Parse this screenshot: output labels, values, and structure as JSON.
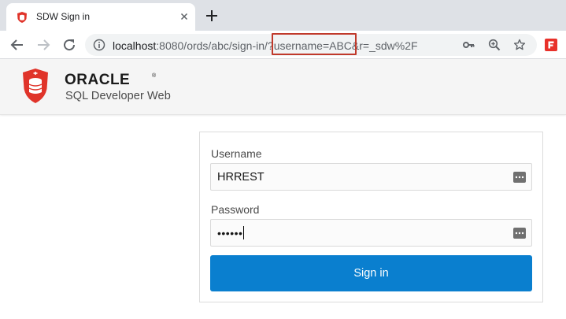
{
  "browser": {
    "tab": {
      "title": "SDW Sign in",
      "favicon": "sdw-shield-icon"
    },
    "new_tab_icon": "plus-icon",
    "address_bar": {
      "host": "localhost",
      "rest": ":8080/ords/abc/sign-in/?username=ABC&r=_sdw%2F",
      "highlighted_text": "?username=ABC&"
    },
    "icons": [
      "back-icon",
      "forward-icon",
      "reload-icon",
      "info-icon",
      "key-icon",
      "zoom-icon",
      "star-icon",
      "extension-icon"
    ]
  },
  "header": {
    "brand": "ORACLE",
    "trademark": "®",
    "product": "SQL Developer Web",
    "colors": {
      "logo_red": "#e0342a",
      "header_bg": "#f5f5f5"
    }
  },
  "login": {
    "username_label": "Username",
    "username_value": "HRREST",
    "password_label": "Password",
    "password_mask": "••••••",
    "signin_label": "Sign in",
    "colors": {
      "button": "#0a7fcf"
    }
  }
}
